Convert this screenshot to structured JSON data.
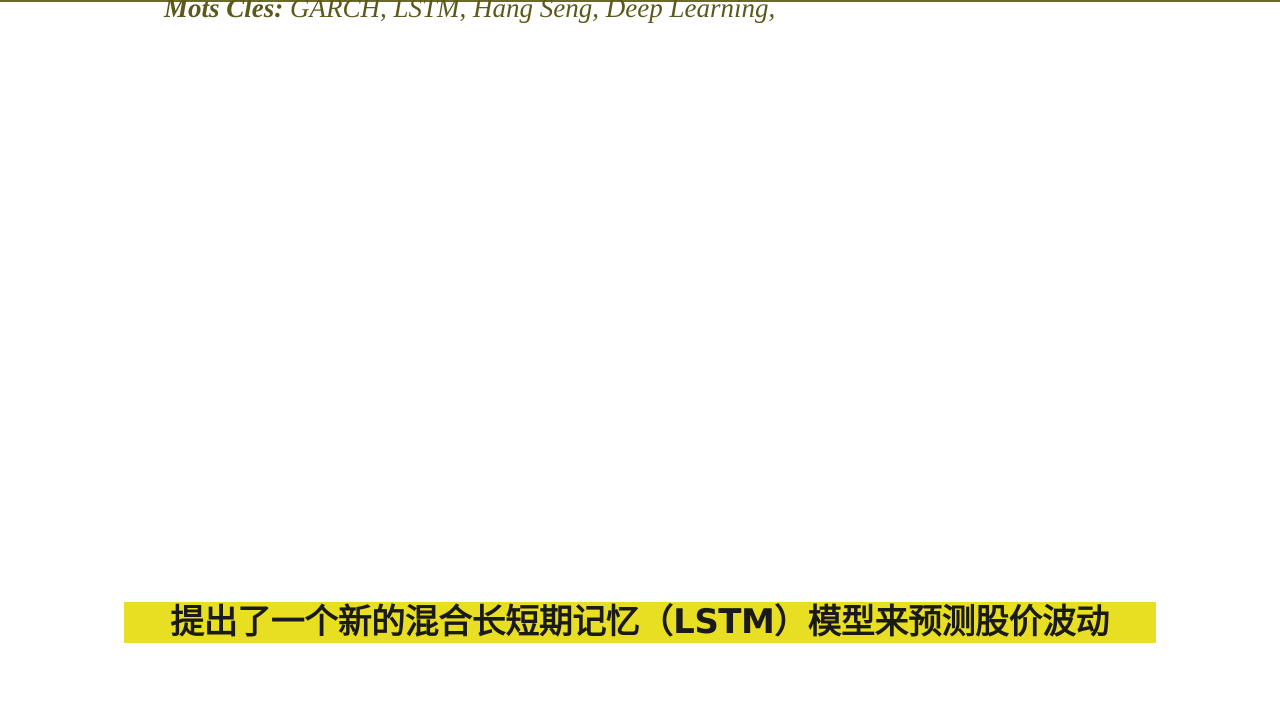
{
  "document": {
    "keywords_label": "Mots Clés:",
    "keywords_text": " GARCH, LSTM, Hang Seng, Deep Learning,"
  },
  "subtitle": {
    "text": "提出了一个新的混合长短期记忆（LSTM）模型来预测股价波动"
  },
  "colors": {
    "background": "#ffffff",
    "document_text": "#5c5a1a",
    "subtitle_bar": "#e9df22",
    "subtitle_text": "#1a1a1a"
  }
}
